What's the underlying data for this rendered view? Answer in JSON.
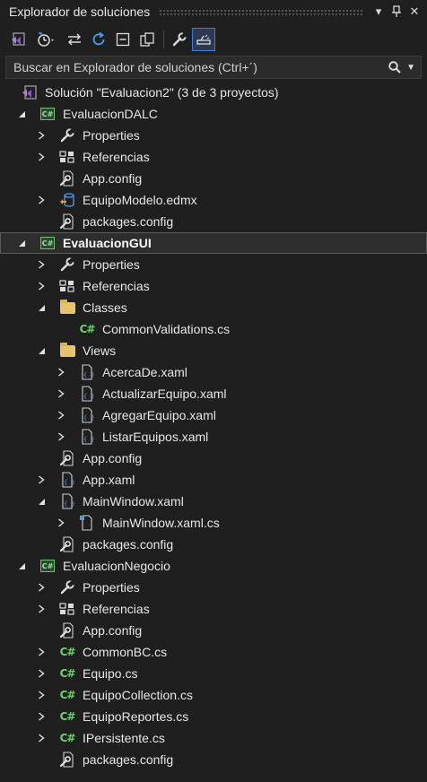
{
  "window": {
    "title": "Explorador de soluciones",
    "controls": [
      {
        "name": "dropdown-icon",
        "glyph": "▾"
      },
      {
        "name": "pin-icon",
        "glyph": "⊥"
      },
      {
        "name": "close-icon",
        "glyph": "✕"
      }
    ]
  },
  "toolbar": {
    "tools": [
      {
        "name": "vs-solution-switch-icon",
        "sep_after": false
      },
      {
        "name": "history-icon",
        "sep_after": false
      },
      {
        "name": "sync-icon",
        "sep_after": false
      },
      {
        "name": "refresh-icon",
        "sep_after": false
      },
      {
        "name": "collapse-all-icon",
        "sep_after": false
      },
      {
        "name": "show-all-files-icon",
        "sep_after": true
      },
      {
        "name": "properties-wrench-icon",
        "sep_after": false
      },
      {
        "name": "preview-selected-icon",
        "active": true
      }
    ]
  },
  "search": {
    "placeholder": "Buscar en Explorador de soluciones (Ctrl+´)"
  },
  "colors": {
    "background": "#1f1f1f",
    "accent": "#3d7dd8",
    "csharp": "#6fcf6f",
    "folder": "#d9b45c"
  },
  "tree": {
    "nodes": [
      {
        "label": "Solución \"Evaluacion2\"  (3 de 3 proyectos)",
        "depth": 0,
        "expander": "none",
        "icon": "solution-icon"
      },
      {
        "label": "EvaluacionDALC",
        "depth": 1,
        "expander": "expanded",
        "icon": "csharp-project-icon"
      },
      {
        "label": "Properties",
        "depth": 2,
        "expander": "collapsed",
        "icon": "wrench-icon"
      },
      {
        "label": "Referencias",
        "depth": 2,
        "expander": "collapsed",
        "icon": "references-icon"
      },
      {
        "label": "App.config",
        "depth": 2,
        "expander": "none",
        "icon": "config-file-icon"
      },
      {
        "label": "EquipoModelo.edmx",
        "depth": 2,
        "expander": "collapsed",
        "icon": "edmx-icon"
      },
      {
        "label": "packages.config",
        "depth": 2,
        "expander": "none",
        "icon": "config-file-icon"
      },
      {
        "label": "EvaluacionGUI",
        "depth": 1,
        "expander": "expanded",
        "icon": "csharp-project-icon",
        "selected": true
      },
      {
        "label": "Properties",
        "depth": 2,
        "expander": "collapsed",
        "icon": "wrench-icon"
      },
      {
        "label": "Referencias",
        "depth": 2,
        "expander": "collapsed",
        "icon": "references-icon"
      },
      {
        "label": "Classes",
        "depth": 2,
        "expander": "expanded",
        "icon": "folder-open-icon"
      },
      {
        "label": "CommonValidations.cs",
        "depth": 3,
        "expander": "none",
        "icon": "csharp-file-icon"
      },
      {
        "label": "Views",
        "depth": 2,
        "expander": "expanded",
        "icon": "folder-open-icon"
      },
      {
        "label": "AcercaDe.xaml",
        "depth": 3,
        "expander": "collapsed",
        "icon": "xaml-file-icon"
      },
      {
        "label": "ActualizarEquipo.xaml",
        "depth": 3,
        "expander": "collapsed",
        "icon": "xaml-file-icon"
      },
      {
        "label": "AgregarEquipo.xaml",
        "depth": 3,
        "expander": "collapsed",
        "icon": "xaml-file-icon"
      },
      {
        "label": "ListarEquipos.xaml",
        "depth": 3,
        "expander": "collapsed",
        "icon": "xaml-file-icon"
      },
      {
        "label": "App.config",
        "depth": 2,
        "expander": "none",
        "icon": "config-file-icon"
      },
      {
        "label": "App.xaml",
        "depth": 2,
        "expander": "collapsed",
        "icon": "xaml-file-icon"
      },
      {
        "label": "MainWindow.xaml",
        "depth": 2,
        "expander": "expanded",
        "icon": "xaml-file-icon"
      },
      {
        "label": "MainWindow.xaml.cs",
        "depth": 3,
        "expander": "collapsed",
        "icon": "code-behind-icon"
      },
      {
        "label": "packages.config",
        "depth": 2,
        "expander": "none",
        "icon": "config-file-icon"
      },
      {
        "label": "EvaluacionNegocio",
        "depth": 1,
        "expander": "expanded",
        "icon": "csharp-project-icon"
      },
      {
        "label": "Properties",
        "depth": 2,
        "expander": "collapsed",
        "icon": "wrench-icon"
      },
      {
        "label": "Referencias",
        "depth": 2,
        "expander": "collapsed",
        "icon": "references-icon"
      },
      {
        "label": "App.config",
        "depth": 2,
        "expander": "none",
        "icon": "config-file-icon"
      },
      {
        "label": "CommonBC.cs",
        "depth": 2,
        "expander": "collapsed",
        "icon": "csharp-file-icon"
      },
      {
        "label": "Equipo.cs",
        "depth": 2,
        "expander": "collapsed",
        "icon": "csharp-file-icon"
      },
      {
        "label": "EquipoCollection.cs",
        "depth": 2,
        "expander": "collapsed",
        "icon": "csharp-file-icon"
      },
      {
        "label": "EquipoReportes.cs",
        "depth": 2,
        "expander": "collapsed",
        "icon": "csharp-file-icon"
      },
      {
        "label": "IPersistente.cs",
        "depth": 2,
        "expander": "collapsed",
        "icon": "csharp-file-icon"
      },
      {
        "label": "packages.config",
        "depth": 2,
        "expander": "none",
        "icon": "config-file-icon"
      }
    ]
  }
}
